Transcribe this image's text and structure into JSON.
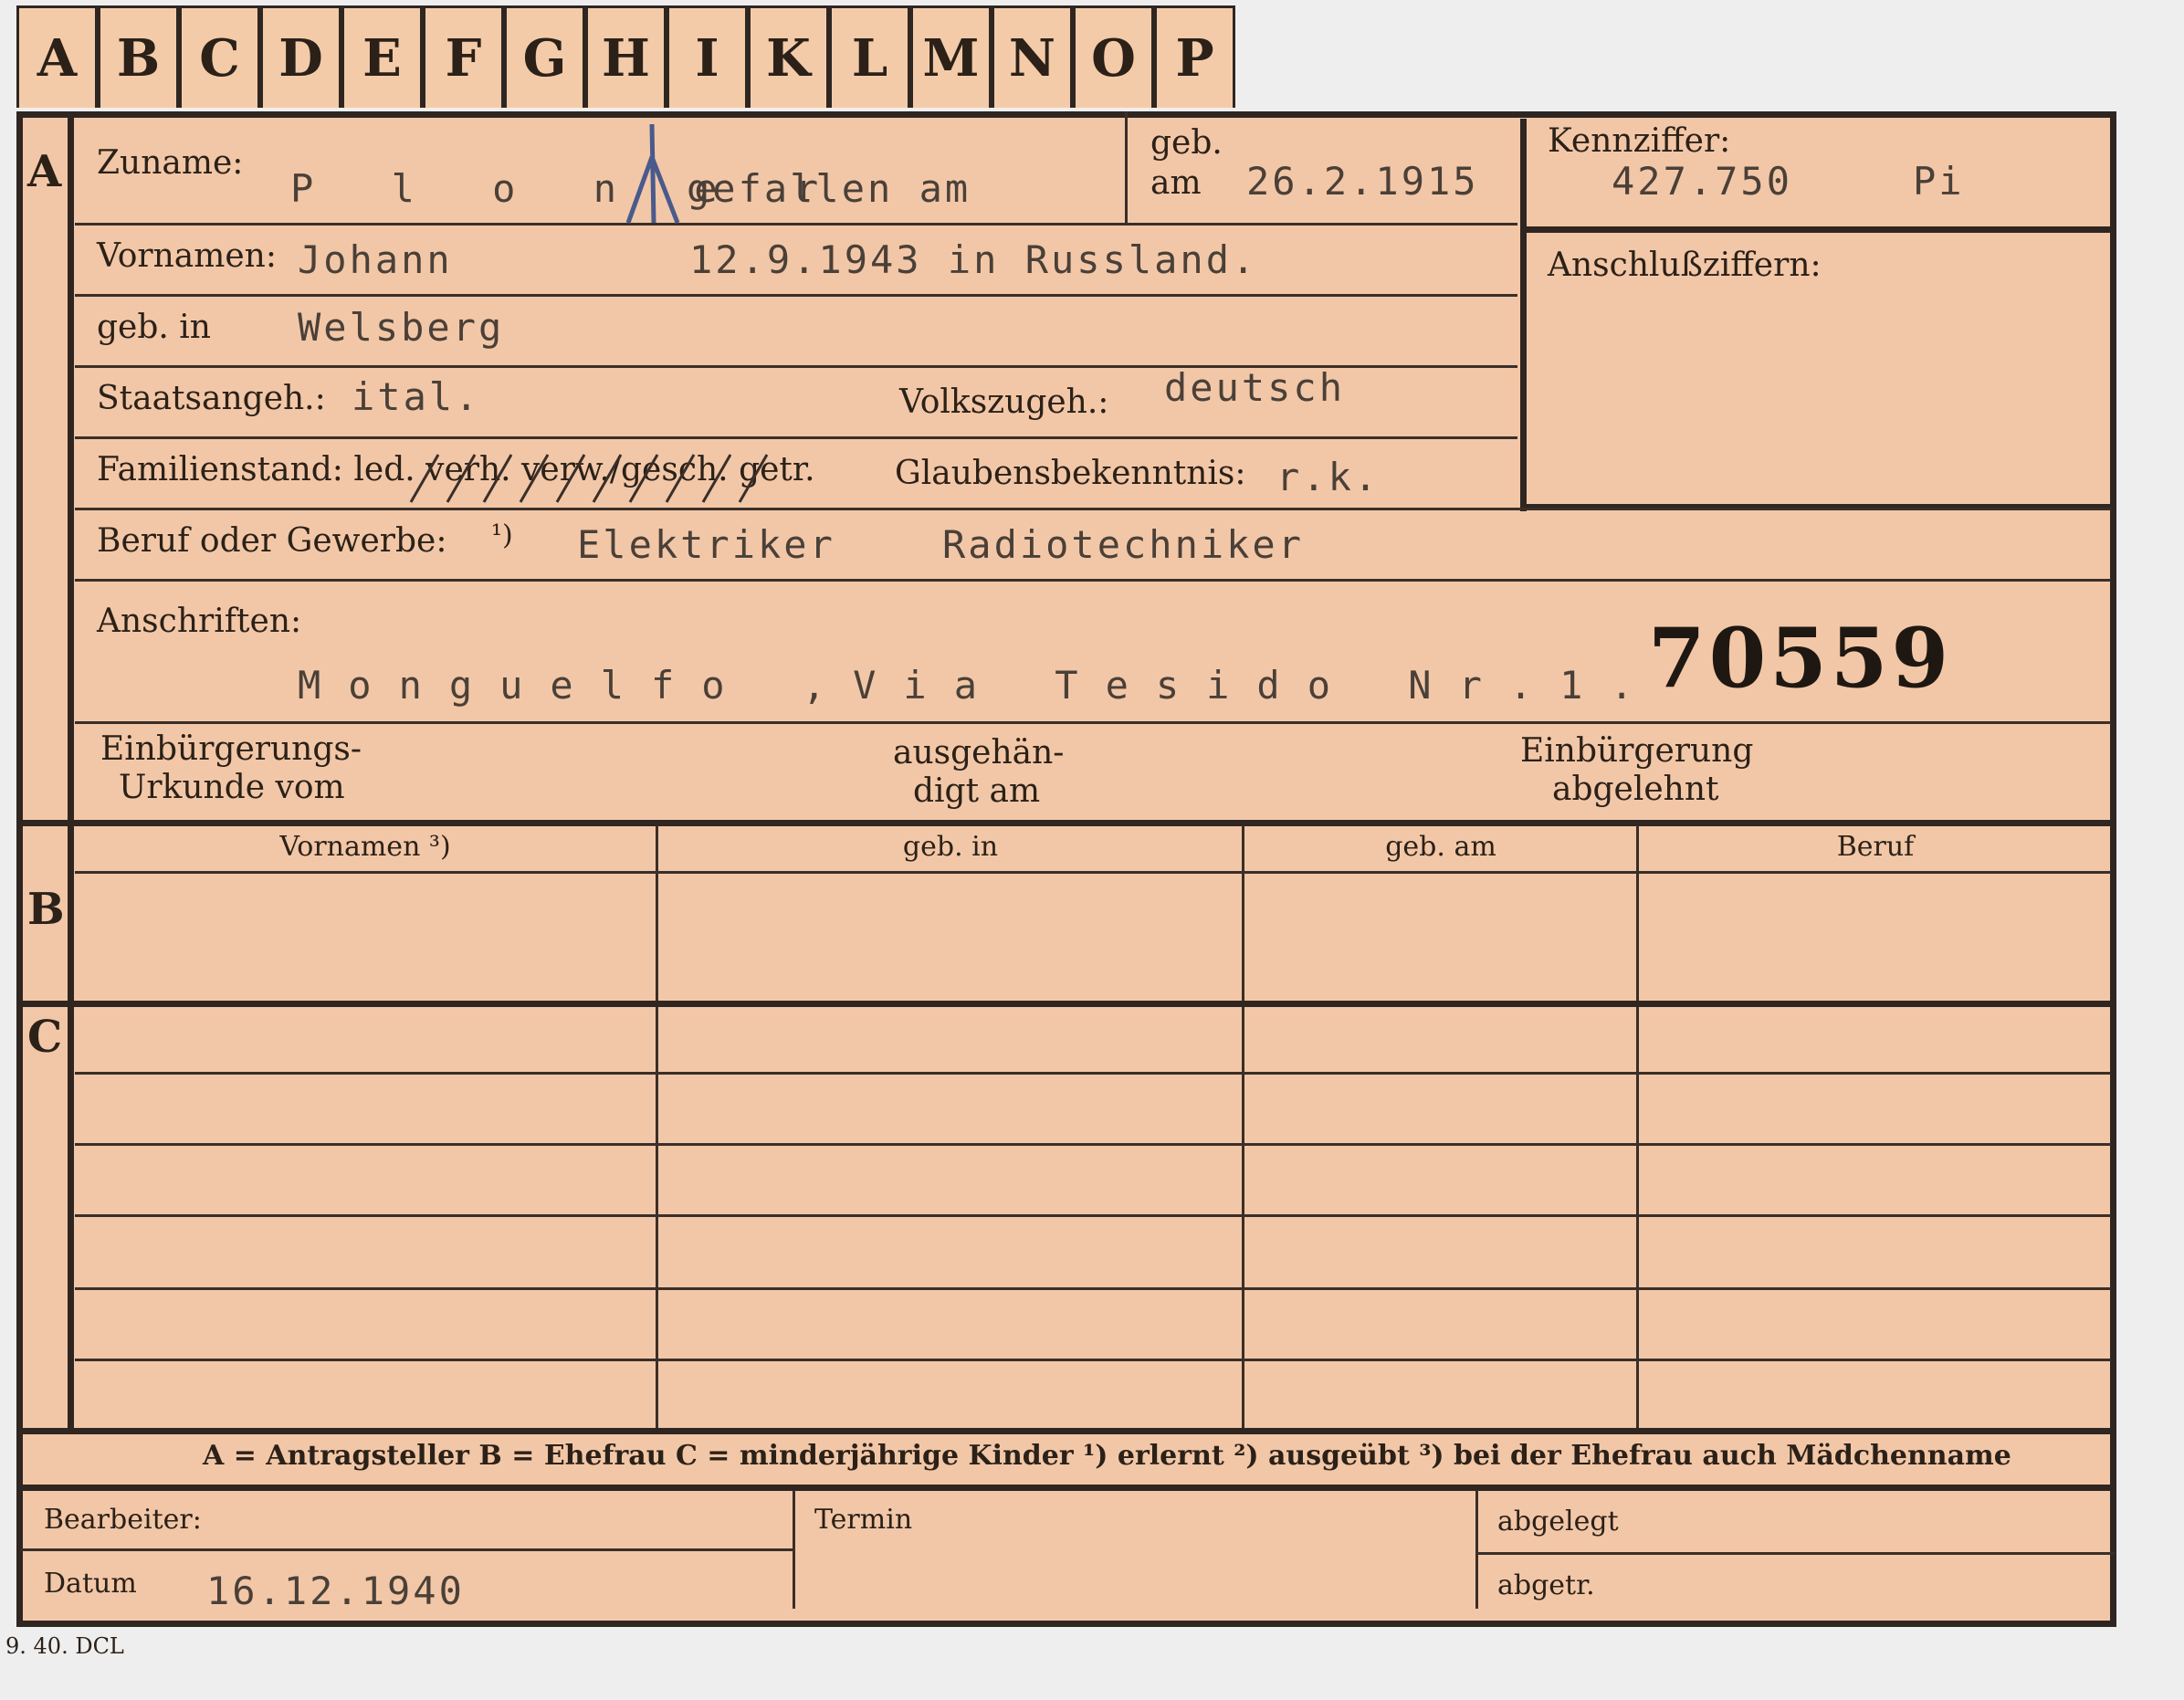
{
  "tabs": [
    "A",
    "B",
    "C",
    "D",
    "E",
    "F",
    "G",
    "H",
    "I",
    "K",
    "L",
    "M",
    "N",
    "O",
    "P"
  ],
  "sections": {
    "a": "A",
    "b": "B",
    "c": "C"
  },
  "labels": {
    "zuname": "Zuname:",
    "geb_am_1": "geb.",
    "geb_am_2": "am",
    "kennziffer": "Kennziffer:",
    "vornamen": "Vornamen:",
    "anschlussziffern": "Anschlußziffern:",
    "geb_in": "geb. in",
    "staatsangeh": "Staatsangeh.:",
    "volkszugeh": "Volkszugeh.:",
    "familienstand": "Familienstand: led. verh. verw./gesch. getr.",
    "glaubensbekenntnis": "Glaubensbekenntnis:",
    "beruf": "Beruf oder Gewerbe:",
    "beruf_note": "¹)",
    "anschriften": "Anschriften:",
    "einbuergerungs_1": "Einbürgerungs-",
    "einbuergerungs_2": "Urkunde vom",
    "ausgehaen_1": "ausgehän-",
    "ausgehaen_2": "digt am",
    "einbuergerung_abg_1": "Einbürgerung",
    "einbuergerung_abg_2": "abgelehnt",
    "legend": "A = Antragsteller   B = Ehefrau   C = minderjährige Kinder   ¹) erlernt   ²) ausgeübt   ³) bei der Ehefrau auch Mädchenname",
    "bearbeiter": "Bearbeiter:",
    "termin": "Termin",
    "abgelegt": "abgelegt",
    "datum": "Datum",
    "abgetr": "abgetr.",
    "footer_code": "9. 40. DCL"
  },
  "columns": [
    "Vornamen ³)",
    "geb. in",
    "geb. am",
    "Beruf"
  ],
  "values": {
    "zuname": "P l o n e r",
    "gefallen": "gefallen am",
    "geb_am": "26.2.1915",
    "kennziffer": "427.750",
    "kennziffer_suffix": "Pi",
    "vornamen": "Johann",
    "gefallen_date": "12.9.1943 in Russland.",
    "geb_in": "Welsberg",
    "staatsangeh": "ital.",
    "volkszugeh": "deutsch",
    "glaubensbekenntnis": "r.k.",
    "beruf_1": "Elektriker",
    "beruf_2": "Radiotechniker",
    "anschrift": "Monguelfo ,Via Tesido Nr.1.",
    "card_number": "70559",
    "datum": "16.12.1940"
  },
  "colors": {
    "card": "#f2c7a7",
    "ink": "#2b2118",
    "typewriter": "#4a4038",
    "rule": "#2f2621",
    "pencil_mark": "#4a5a8c"
  }
}
